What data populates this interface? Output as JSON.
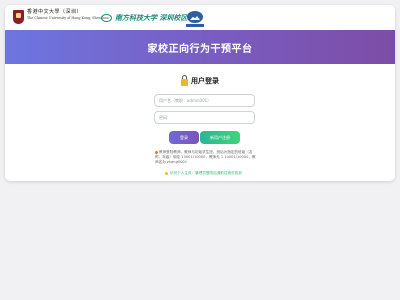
{
  "header": {
    "cuhk_name_cn": "香港中文大學（深圳）",
    "cuhk_name_en": "The Chinese University of Hong Kong, Shenzhen",
    "nsu_name": "南方科技大学 深圳校区"
  },
  "banner": {
    "title": "家校正向行为干预平台"
  },
  "login": {
    "title": "用户登录",
    "username_placeholder": "用户名（教职：admin001）",
    "password_placeholder": "密码",
    "login_label": "登录",
    "register_label": "新用户注册"
  },
  "notice": {
    "text": "教师登陆教师，教师与初始学生班，然后为指定的班级（名称、年级）绑定 10001/10000，教师无 1 10001/10000，教师名为 zhang0001"
  },
  "guide": {
    "text": "访问个人主页：管理员登陆后请前往首页找到"
  },
  "colors": {
    "banner_start": "#6d76e0",
    "banner_end": "#7c4da6",
    "login_button": "#7360c8",
    "register_button": "#35c587"
  }
}
